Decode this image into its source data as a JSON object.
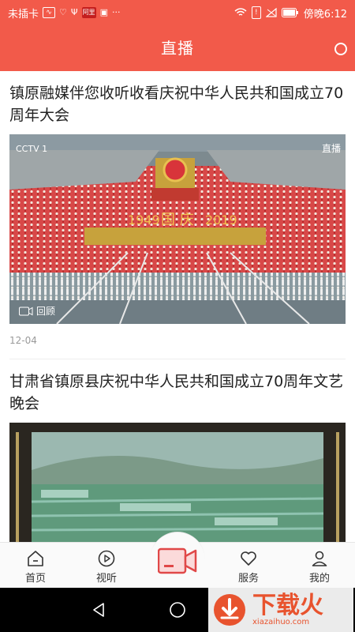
{
  "status_bar": {
    "carrier": "未插卡",
    "time_label": "傍晚6:12",
    "badge_text": "阿里",
    "battery_text": "!"
  },
  "header": {
    "title": "直播"
  },
  "feed": [
    {
      "title": "镇原融媒伴您收听收看庆祝中华人民共和国成立70周年大会",
      "date": "12-04",
      "replay_label": "回顾",
      "image_caption_left": "1949",
      "image_caption_center": "国 庆",
      "image_caption_right": "2019",
      "channel_logo": "CCTV 1",
      "live_tag": "直播"
    },
    {
      "title": "甘肃省镇原县庆祝中华人民共和国成立70周年文艺晚会"
    }
  ],
  "tabbar": {
    "items": [
      {
        "label": "首页",
        "icon": "home-icon"
      },
      {
        "label": "视听",
        "icon": "play-icon"
      },
      {
        "label": "",
        "icon": "video-camera-icon"
      },
      {
        "label": "服务",
        "icon": "heart-icon"
      },
      {
        "label": "我的",
        "icon": "user-icon"
      }
    ]
  },
  "watermark": {
    "title": "下载火",
    "url": "xiazaihuo.com"
  },
  "colors": {
    "accent": "#f25a4a",
    "watermark": "#e8532e"
  }
}
